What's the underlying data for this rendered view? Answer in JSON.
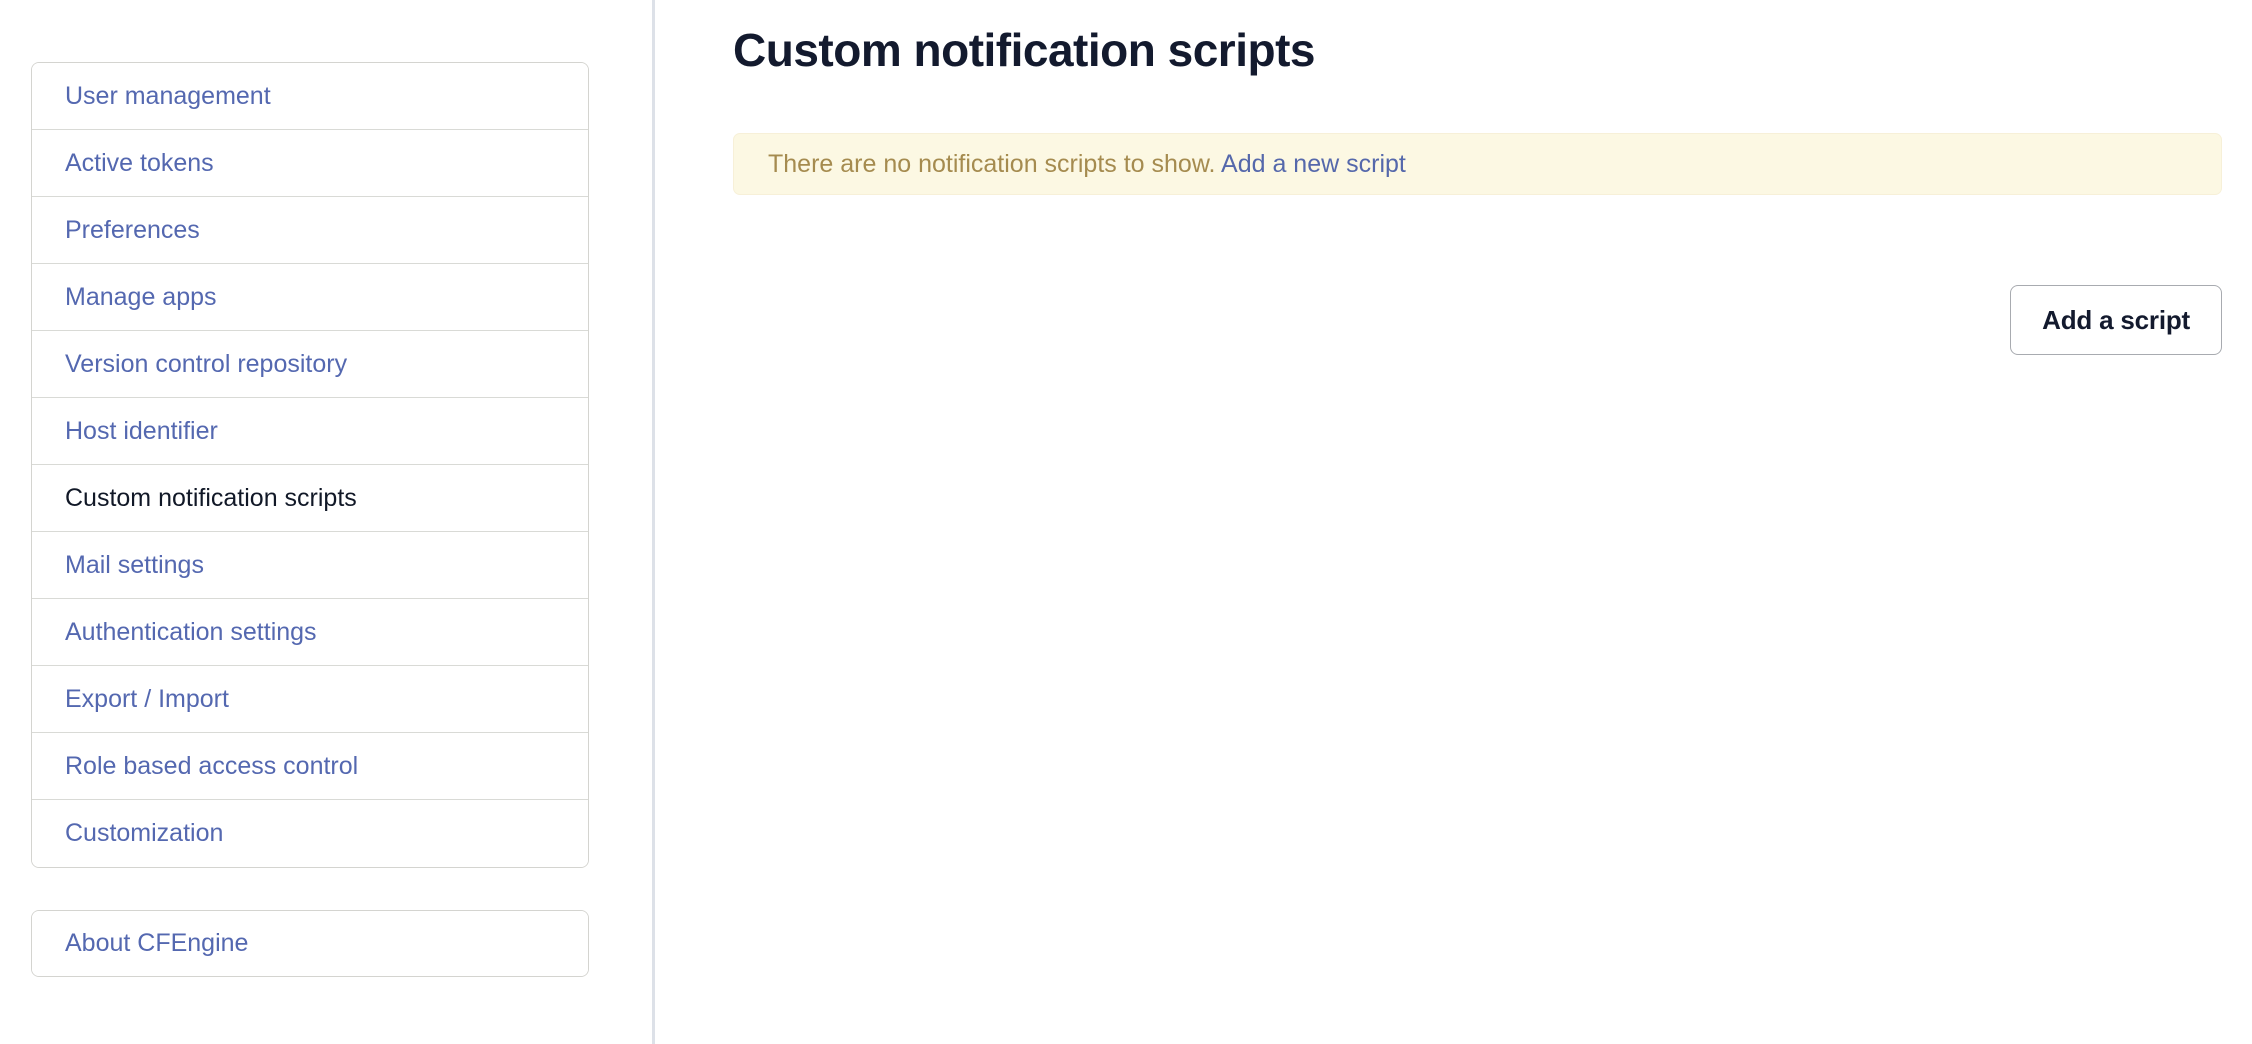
{
  "colors": {
    "link": "#5468b0",
    "active_text": "#111827",
    "title": "#131a2e",
    "alert_bg": "#fcf8e3",
    "alert_border": "#f7f0d8",
    "alert_text": "#a58b4f",
    "alert_link": "#5568ab",
    "card_border": "#d4d4d0",
    "divider": "#dde1e8",
    "button_border": "#a8abb0"
  },
  "sidebar": {
    "items": [
      {
        "label": "User management",
        "active": false
      },
      {
        "label": "Active tokens",
        "active": false
      },
      {
        "label": "Preferences",
        "active": false
      },
      {
        "label": "Manage apps",
        "active": false
      },
      {
        "label": "Version control repository",
        "active": false
      },
      {
        "label": "Host identifier",
        "active": false
      },
      {
        "label": "Custom notification scripts",
        "active": true
      },
      {
        "label": "Mail settings",
        "active": false
      },
      {
        "label": "Authentication settings",
        "active": false
      },
      {
        "label": "Export / Import",
        "active": false
      },
      {
        "label": "Role based access control",
        "active": false
      },
      {
        "label": "Customization",
        "active": false
      }
    ],
    "about": {
      "label": "About CFEngine"
    }
  },
  "main": {
    "title": "Custom notification scripts",
    "alert": {
      "message": "There are no notification scripts to show.",
      "link_label": "Add a new script"
    },
    "add_button_label": "Add a script"
  }
}
